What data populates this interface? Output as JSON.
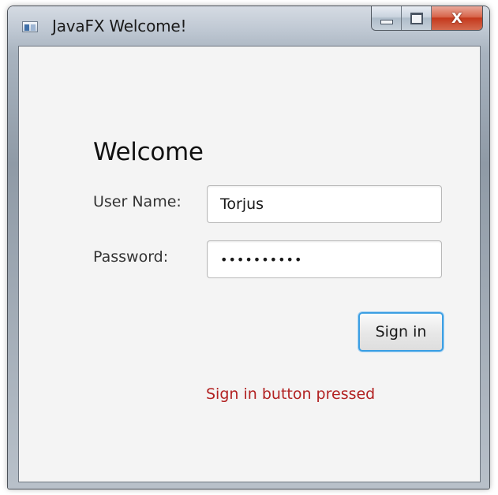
{
  "window": {
    "title": "JavaFX Welcome!",
    "close_glyph": "X"
  },
  "form": {
    "heading": "Welcome",
    "username_label": "User Name:",
    "username_value": "Torjus",
    "password_label": "Password:",
    "password_value": "••••••••••",
    "signin_label": "Sign in",
    "status_message": "Sign in button pressed"
  },
  "colors": {
    "status_text": "#b22222",
    "focus_ring": "#3c9fe3",
    "close_button": "#c4391d"
  },
  "icons": [
    "app-icon",
    "minimize-icon",
    "maximize-icon",
    "close-icon"
  ]
}
